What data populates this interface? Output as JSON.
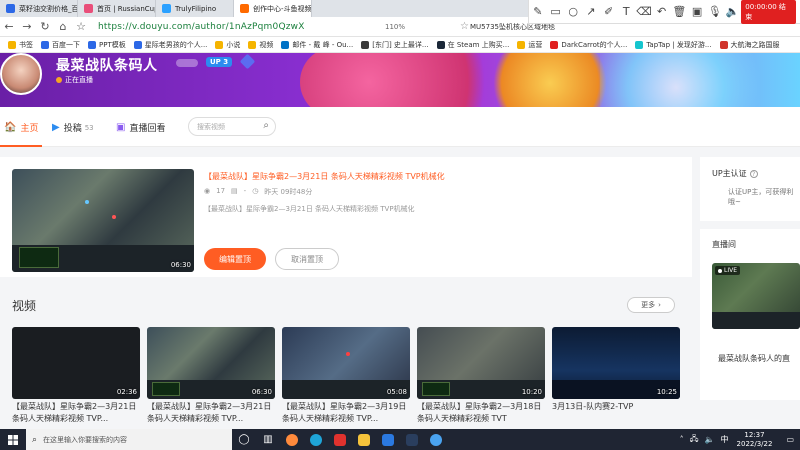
{
  "browser": {
    "tabs": [
      {
        "label": "菜籽油交割价格_百度搜索",
        "color": "#2c68e6",
        "active": false
      },
      {
        "label": "首页 | RussianCupid.com",
        "color": "#e94f7a",
        "active": false
      },
      {
        "label": "TrulyFilipino",
        "color": "#2ba1ff",
        "active": false
      },
      {
        "label": "创作中心-斗鱼视频",
        "color": "#ff6a00",
        "active": true
      }
    ],
    "url": "https://v.douyu.com/author/1nAzPqm0QzwX",
    "zoom": "110%",
    "extension_text": "MU5735坠机核心区域地毯",
    "bookmarks": [
      {
        "label": "书签",
        "color": "#f5b400"
      },
      {
        "label": "百度一下",
        "color": "#2c68e6"
      },
      {
        "label": "PPT模板",
        "color": "#2c68e6"
      },
      {
        "label": "星际老男孩的个人...",
        "color": "#2c68e6"
      },
      {
        "label": "小说",
        "color": "#f5b400"
      },
      {
        "label": "视频",
        "color": "#f5b400"
      },
      {
        "label": "邮件 - 戴 峰 - Ou...",
        "color": "#0072c6"
      },
      {
        "label": "[东门] 史上最详...",
        "color": "#3a3a3a"
      },
      {
        "label": "在 Steam 上购买...",
        "color": "#1b2838"
      },
      {
        "label": "运营",
        "color": "#f5b400"
      },
      {
        "label": "DarkCarrot的个人...",
        "color": "#e02020"
      },
      {
        "label": "TapTap | 发现好游...",
        "color": "#15c5ce"
      },
      {
        "label": "大航海之路国服",
        "color": "#d0342c"
      }
    ]
  },
  "recorder": {
    "timer": "00:00:00 结束"
  },
  "profile": {
    "name": "最菜战队条码人",
    "level": "UP 3",
    "status": "正在直播"
  },
  "nav": {
    "tabs": [
      {
        "label": "主页",
        "count": "",
        "icon": "home-icon"
      },
      {
        "label": "投稿",
        "count": "53",
        "icon": "upload-icon"
      },
      {
        "label": "直播回看",
        "count": "",
        "icon": "replay-icon"
      }
    ],
    "search_placeholder": "搜索视频"
  },
  "pinned": {
    "title": "【最菜战队】星际争霸2—3月21日 条码人天梯精彩视频 TVP机械化",
    "views": "17",
    "comments": "-",
    "time": "昨天 09时48分",
    "description": "【最菜战队】星际争霸2—3月21日 条码人天梯精彩视频 TVP机械化",
    "duration": "06:30",
    "edit_label": "编辑置顶",
    "cancel_label": "取消置顶"
  },
  "videos_section": {
    "title": "视频",
    "more_label": "更多",
    "items": [
      {
        "caption": "【最菜战队】星际争霸2—3月21日 条码人天梯精彩视频 TVP...",
        "duration": "02:36"
      },
      {
        "caption": "【最菜战队】星际争霸2—3月21日 条码人天梯精彩视频 TVP...",
        "duration": "06:30"
      },
      {
        "caption": "【最菜战队】星际争霸2—3月19日 条码人天梯精彩视频 TVP...",
        "duration": "05:08"
      },
      {
        "caption": "【最菜战队】星际争霸2—3月18日 条码人天梯精彩视频 TVT",
        "duration": "10:20"
      },
      {
        "caption": "3月13日-队内赛2-TVP",
        "duration": "10:25"
      }
    ]
  },
  "right": {
    "auth_title": "UP主认证",
    "auth_desc": "认证UP主，可获得利哦~",
    "live_title": "直播间",
    "live_tag": "LIVE",
    "live_caption": "最菜战队条码人的直"
  },
  "taskbar": {
    "search_placeholder": "在这里输入你要搜索的内容",
    "time": "12:37",
    "date": "2022/3/22",
    "ime": "中"
  }
}
